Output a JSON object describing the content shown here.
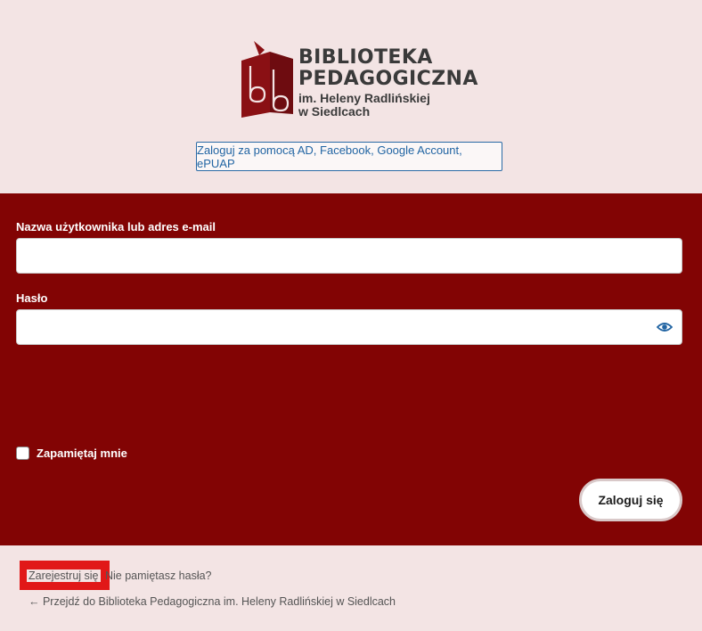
{
  "logo": {
    "title_line1": "BIBLIOTEKA",
    "title_line2": "PEDAGOGICZNA",
    "sub_line1": "im. Heleny Radlińskiej",
    "sub_line2": "w Siedlcach",
    "color": "#8a1014"
  },
  "sso": {
    "label": "Zaloguj za pomocą AD, Facebook, Google Account, ePUAP"
  },
  "form": {
    "username_label": "Nazwa użytkownika lub adres e-mail",
    "username_value": "",
    "password_label": "Hasło",
    "password_value": "",
    "remember_label": "Zapamiętaj mnie",
    "remember_checked": false,
    "submit_label": "Zaloguj się"
  },
  "footer": {
    "register_label": "Zarejestruj się",
    "forgot_label": "Nie pamiętasz hasła?",
    "separator": "|",
    "back_label": "← Przejdź do Biblioteka Pedagogiczna im. Heleny Radlińskiej w Siedlcach"
  },
  "colors": {
    "page_bg": "#f3e4e4",
    "panel_bg": "#820404",
    "link_blue": "#2265a3",
    "highlight": "#e11818"
  }
}
